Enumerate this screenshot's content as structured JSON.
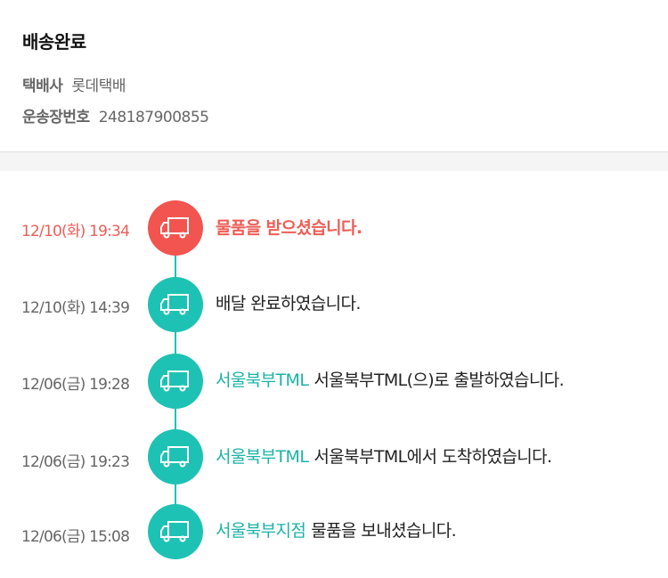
{
  "header": {
    "status_title": "배송완료",
    "courier_label": "택배사",
    "courier_value": "롯데택배",
    "tracking_label": "운송장번호",
    "tracking_value": "248187900855"
  },
  "colors": {
    "accent_teal": "#1ec2b4",
    "accent_red": "#f2554f",
    "location_text": "#1ab3a6"
  },
  "timeline": {
    "events": [
      {
        "time": "12/10(화) 19:34",
        "location": "",
        "message": "물품을 받으셨습니다.",
        "latest": true,
        "icon": "truck-icon"
      },
      {
        "time": "12/10(화) 14:39",
        "location": "",
        "message": "배달 완료하였습니다.",
        "latest": false,
        "icon": "truck-icon"
      },
      {
        "time": "12/06(금) 19:28",
        "location": "서울북부TML",
        "message": "서울북부TML(으)로 출발하였습니다.",
        "latest": false,
        "icon": "truck-icon"
      },
      {
        "time": "12/06(금) 19:23",
        "location": "서울북부TML",
        "message": "서울북부TML에서 도착하였습니다.",
        "latest": false,
        "icon": "truck-icon"
      },
      {
        "time": "12/06(금) 15:08",
        "location": "서울북부지점",
        "message": "물품을 보내셨습니다.",
        "latest": false,
        "icon": "truck-icon"
      }
    ]
  }
}
